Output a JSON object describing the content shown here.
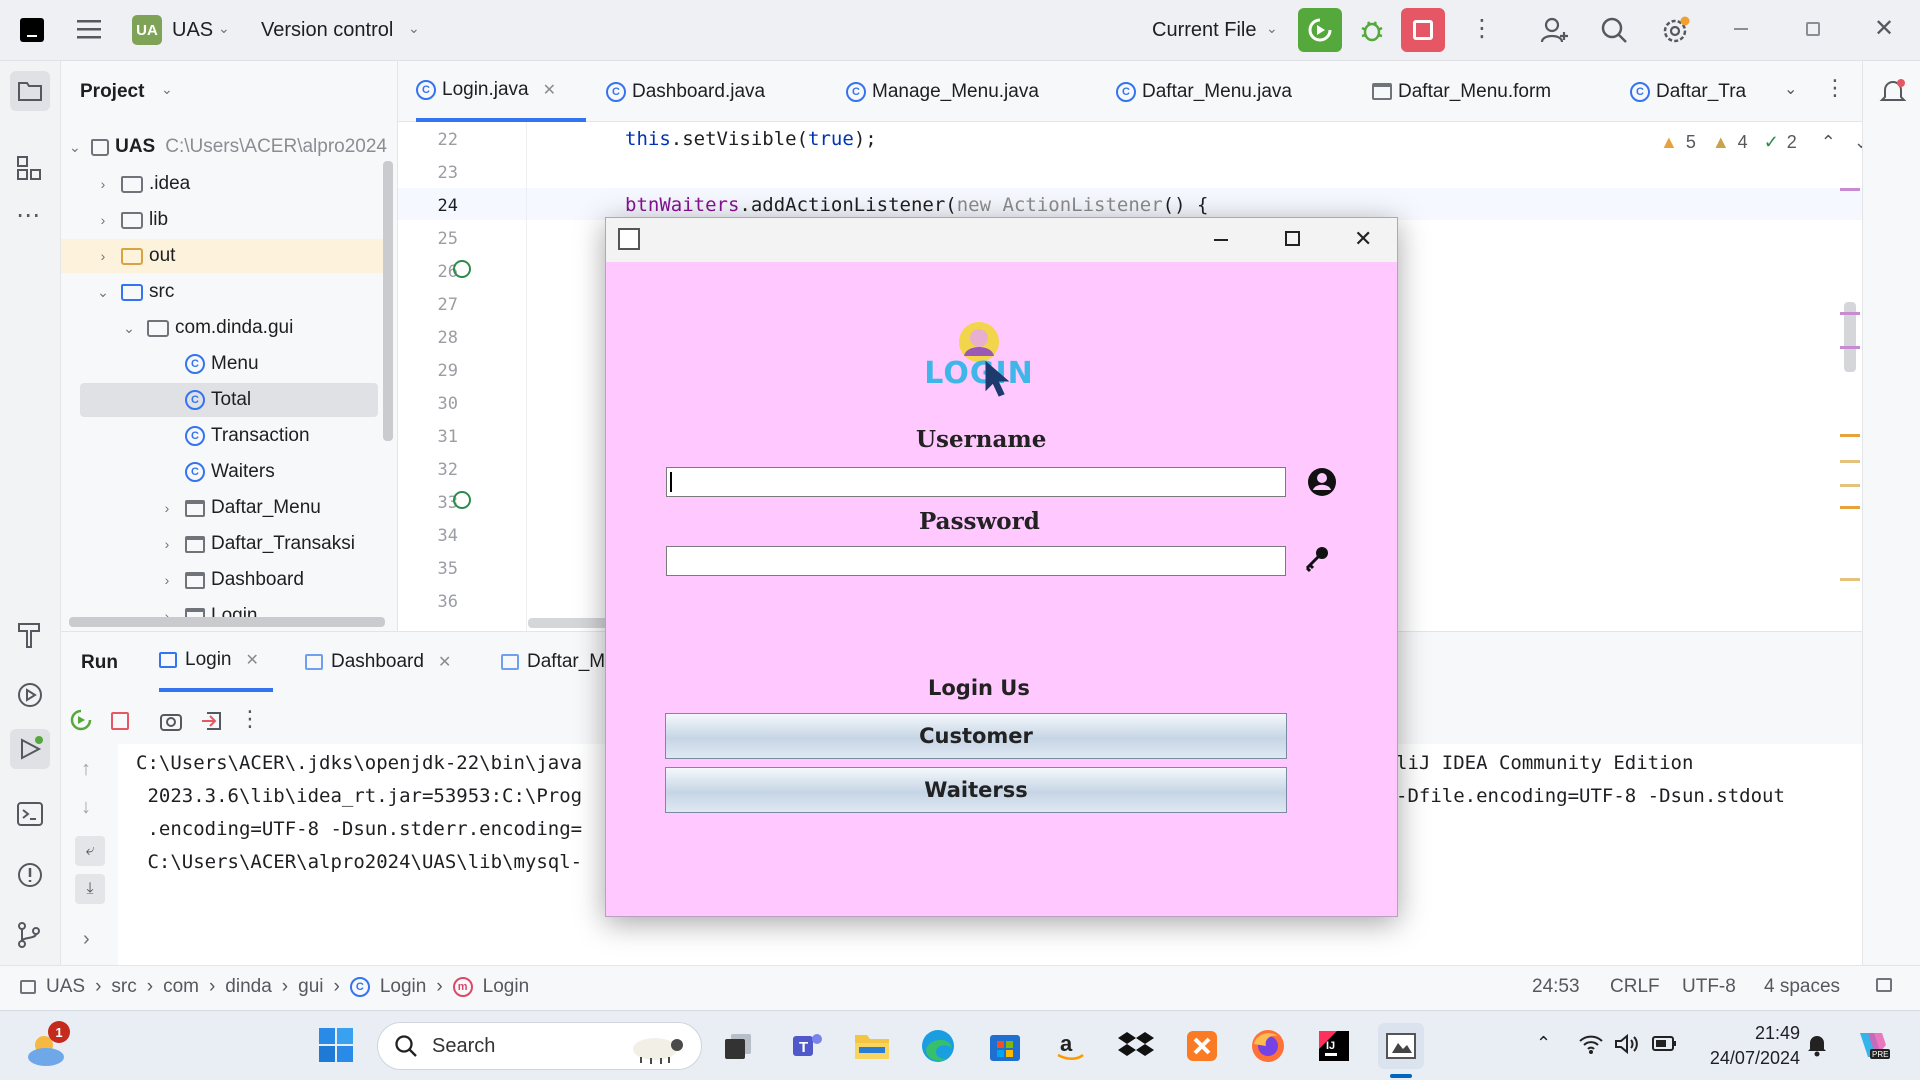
{
  "titlebar": {
    "project_badge": "UA",
    "project_name": "UAS",
    "vcs_label": "Version control",
    "run_config": "Current File"
  },
  "project_panel": {
    "title": "Project",
    "tree": [
      {
        "label": "UAS",
        "path": "C:\\Users\\ACER\\alpro2024",
        "type": "module",
        "expanded": true
      },
      {
        "label": ".idea",
        "type": "folder"
      },
      {
        "label": "lib",
        "type": "folder"
      },
      {
        "label": "out",
        "type": "folder-excluded"
      },
      {
        "label": "src",
        "type": "folder",
        "expanded": true
      },
      {
        "label": "com.dinda.gui",
        "type": "package",
        "expanded": true
      },
      {
        "label": "Menu",
        "type": "class"
      },
      {
        "label": "Total",
        "type": "class",
        "selected": true
      },
      {
        "label": "Transaction",
        "type": "class"
      },
      {
        "label": "Waiters",
        "type": "class"
      },
      {
        "label": "Daftar_Menu",
        "type": "form"
      },
      {
        "label": "Daftar_Transaksi",
        "type": "form"
      },
      {
        "label": "Dashboard",
        "type": "form"
      },
      {
        "label": "Login",
        "type": "form"
      }
    ]
  },
  "editor": {
    "tabs": [
      {
        "label": "Login.java",
        "active": true
      },
      {
        "label": "Dashboard.java"
      },
      {
        "label": "Manage_Menu.java"
      },
      {
        "label": "Daftar_Menu.java"
      },
      {
        "label": "Daftar_Menu.form"
      },
      {
        "label": "Daftar_Tra"
      }
    ],
    "inspections": {
      "warnings": "5",
      "weak_warnings": "4",
      "ok": "2"
    },
    "line_numbers": [
      "22",
      "23",
      "24",
      "25",
      "26",
      "27",
      "28",
      "29",
      "30",
      "31",
      "32",
      "33",
      "34",
      "35",
      "36"
    ],
    "code": {
      "line22_obj": "this",
      "line22_call": ".setVisible(",
      "line22_val": "true",
      "line22_end": ");",
      "line24_field": "btnWaiters",
      "line24_call": ".addActionListener(",
      "line24_new": "new",
      "line24_type": "ActionListener",
      "line24_end": "() {"
    }
  },
  "run_panel": {
    "title": "Run",
    "tabs": [
      {
        "label": "Login",
        "active": true
      },
      {
        "label": "Dashboard"
      },
      {
        "label": "Daftar_M"
      }
    ],
    "console": [
      {
        "left": "C:\\Users\\ACER\\.jdks\\openjdk-22\\bin\\java",
        "right": "liJ IDEA Community Edition"
      },
      {
        "left": " 2023.3.6\\lib\\idea_rt.jar=53953:C:\\Prog",
        "right": "-Dfile.encoding=UTF-8 -Dsun.stdout"
      },
      {
        "left": " .encoding=UTF-8 -Dsun.stderr.encoding=",
        "right": ""
      },
      {
        "left": " C:\\Users\\ACER\\alpro2024\\UAS\\lib\\mysql-",
        "right": ""
      }
    ]
  },
  "statusbar": {
    "breadcrumb": [
      "UAS",
      "src",
      "com",
      "dinda",
      "gui",
      "Login",
      "Login"
    ],
    "position": "24:53",
    "line_sep": "CRLF",
    "encoding": "UTF-8",
    "indent": "4 spaces"
  },
  "login_dialog": {
    "logo_text": "LOGIN",
    "username_label": "Username",
    "username_value": "",
    "password_label": "Password",
    "password_value": "",
    "login_as_label": "Login Us",
    "customer_button": "Customer",
    "waiterss_button": "Waiterss",
    "background_color": "#ffc8ff"
  },
  "taskbar": {
    "weather_badge": "1",
    "search_placeholder": "Search",
    "time": "21:49",
    "date": "24/07/2024"
  }
}
